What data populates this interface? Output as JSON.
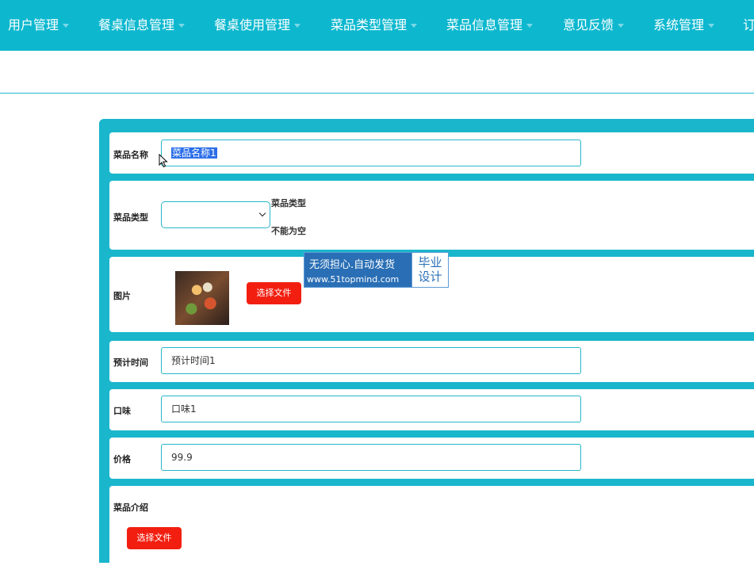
{
  "nav": {
    "items": [
      {
        "label": "用户管理"
      },
      {
        "label": "餐桌信息管理"
      },
      {
        "label": "餐桌使用管理"
      },
      {
        "label": "菜品类型管理"
      },
      {
        "label": "菜品信息管理"
      },
      {
        "label": "意见反馈"
      },
      {
        "label": "系统管理"
      },
      {
        "label": "订"
      }
    ],
    "bg_color": "#0db8cf"
  },
  "form": {
    "dish_name": {
      "label": "菜品名称",
      "value": "菜品名称1"
    },
    "dish_type": {
      "label": "菜品类型",
      "value": "",
      "error_line1": "菜品类型",
      "error_line2": "不能为空"
    },
    "image": {
      "label": "图片",
      "button": "选择文件"
    },
    "est_time": {
      "label": "预计时间",
      "value": "预计时间1"
    },
    "taste": {
      "label": "口味",
      "value": "口味1"
    },
    "price": {
      "label": "价格",
      "value": "99.9"
    },
    "intro": {
      "label": "菜品介绍",
      "button": "选择文件"
    }
  },
  "watermark": {
    "line1": "无须担心.自动发货",
    "line2": "www.51topmind.com",
    "badge_line1": "毕业",
    "badge_line2": "设计"
  },
  "colors": {
    "accent": "#1ab6cc",
    "button_red": "#f21f11",
    "selection": "#2a6ee8"
  }
}
